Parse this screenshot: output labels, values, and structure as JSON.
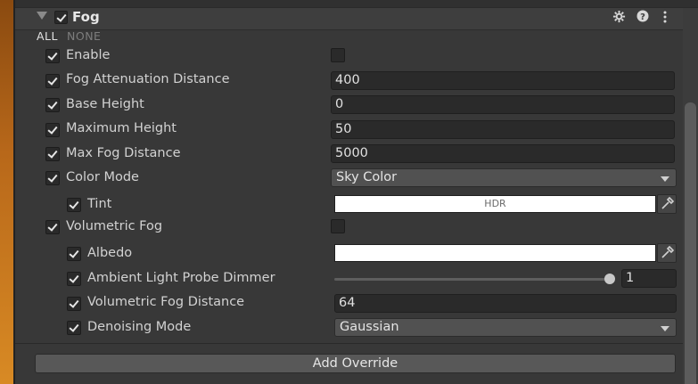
{
  "header": {
    "title": "Fog",
    "enabled": true
  },
  "header_icons": [
    "settings-icon",
    "help-icon",
    "more-icon"
  ],
  "toggles": {
    "all": "ALL",
    "none": "NONE"
  },
  "rows": {
    "enable": {
      "label": "Enable"
    },
    "attenuation": {
      "label": "Fog Attenuation Distance",
      "value": "400"
    },
    "base_height": {
      "label": "Base Height",
      "value": "0"
    },
    "max_height": {
      "label": "Maximum Height",
      "value": "50"
    },
    "max_distance": {
      "label": "Max Fog Distance",
      "value": "5000"
    },
    "color_mode": {
      "label": "Color Mode",
      "value": "Sky Color"
    },
    "tint": {
      "label": "Tint",
      "badge": "HDR",
      "color": "#ffffff"
    },
    "volumetric": {
      "label": "Volumetric Fog"
    },
    "albedo": {
      "label": "Albedo",
      "color": "#ffffff"
    },
    "ambient_dimmer": {
      "label": "Ambient Light Probe Dimmer",
      "value": "1",
      "fraction": 1.0
    },
    "vol_distance": {
      "label": "Volumetric Fog Distance",
      "value": "64"
    },
    "denoising": {
      "label": "Denoising Mode",
      "value": "Gaussian"
    }
  },
  "footer": {
    "add_override": "Add Override"
  },
  "colors": {
    "background": "#383838",
    "field": "#2a2a2a",
    "button": "#585858"
  }
}
